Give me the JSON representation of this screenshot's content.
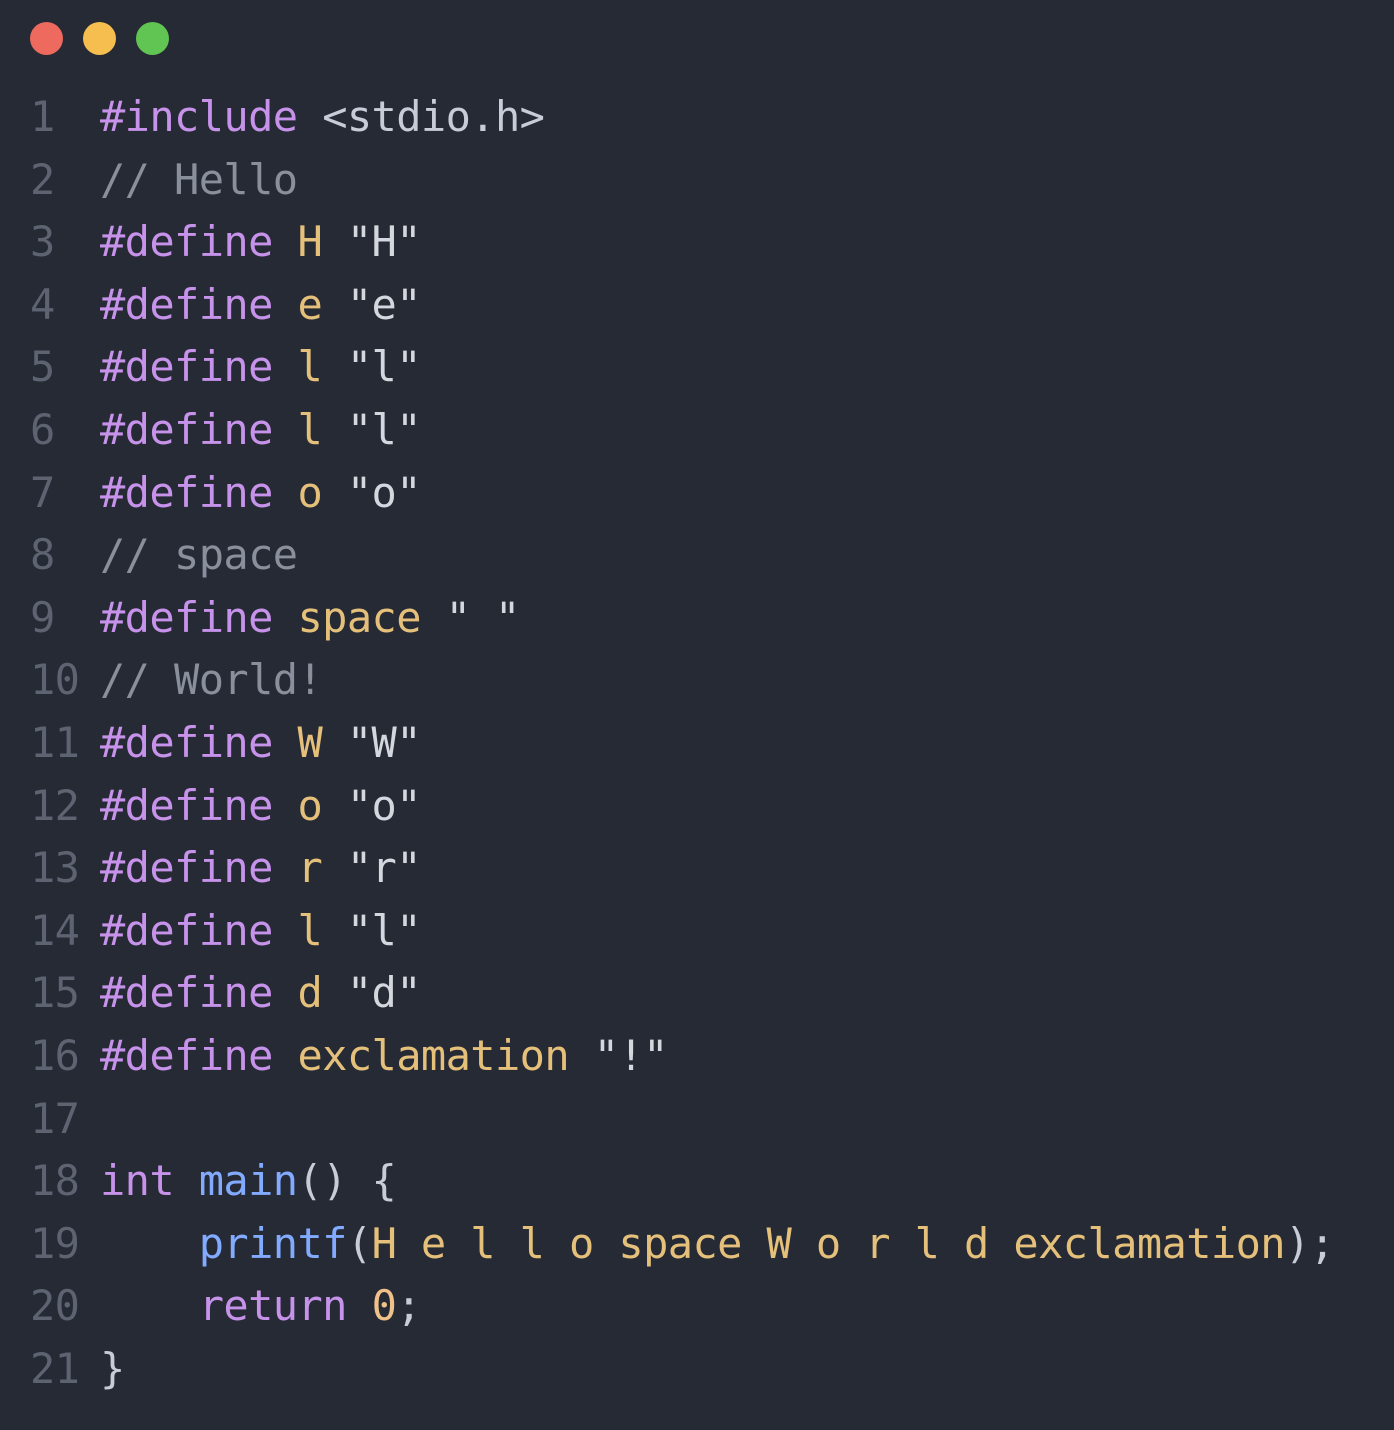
{
  "window": {
    "controls": {
      "close_color": "#ee6a5f",
      "minimize_color": "#f5be4f",
      "maximize_color": "#61c554"
    }
  },
  "editor": {
    "language": "c",
    "lines": [
      {
        "number": "1",
        "tokens": [
          {
            "t": "#include",
            "c": "directive"
          },
          {
            "t": " ",
            "c": "plain"
          },
          {
            "t": "<stdio.h>",
            "c": "header"
          }
        ]
      },
      {
        "number": "2",
        "tokens": [
          {
            "t": "// Hello",
            "c": "comment"
          }
        ]
      },
      {
        "number": "3",
        "tokens": [
          {
            "t": "#define",
            "c": "directive"
          },
          {
            "t": " ",
            "c": "plain"
          },
          {
            "t": "H",
            "c": "macro"
          },
          {
            "t": " ",
            "c": "plain"
          },
          {
            "t": "\"H\"",
            "c": "string"
          }
        ]
      },
      {
        "number": "4",
        "tokens": [
          {
            "t": "#define",
            "c": "directive"
          },
          {
            "t": " ",
            "c": "plain"
          },
          {
            "t": "e",
            "c": "macro"
          },
          {
            "t": " ",
            "c": "plain"
          },
          {
            "t": "\"e\"",
            "c": "string"
          }
        ]
      },
      {
        "number": "5",
        "tokens": [
          {
            "t": "#define",
            "c": "directive"
          },
          {
            "t": " ",
            "c": "plain"
          },
          {
            "t": "l",
            "c": "macro"
          },
          {
            "t": " ",
            "c": "plain"
          },
          {
            "t": "\"l\"",
            "c": "string"
          }
        ]
      },
      {
        "number": "6",
        "tokens": [
          {
            "t": "#define",
            "c": "directive"
          },
          {
            "t": " ",
            "c": "plain"
          },
          {
            "t": "l",
            "c": "macro"
          },
          {
            "t": " ",
            "c": "plain"
          },
          {
            "t": "\"l\"",
            "c": "string"
          }
        ]
      },
      {
        "number": "7",
        "tokens": [
          {
            "t": "#define",
            "c": "directive"
          },
          {
            "t": " ",
            "c": "plain"
          },
          {
            "t": "o",
            "c": "macro"
          },
          {
            "t": " ",
            "c": "plain"
          },
          {
            "t": "\"o\"",
            "c": "string"
          }
        ]
      },
      {
        "number": "8",
        "tokens": [
          {
            "t": "// space",
            "c": "comment"
          }
        ]
      },
      {
        "number": "9",
        "tokens": [
          {
            "t": "#define",
            "c": "directive"
          },
          {
            "t": " ",
            "c": "plain"
          },
          {
            "t": "space",
            "c": "macro"
          },
          {
            "t": " ",
            "c": "plain"
          },
          {
            "t": "\" \"",
            "c": "string"
          }
        ]
      },
      {
        "number": "10",
        "tokens": [
          {
            "t": "// World!",
            "c": "comment"
          }
        ]
      },
      {
        "number": "11",
        "tokens": [
          {
            "t": "#define",
            "c": "directive"
          },
          {
            "t": " ",
            "c": "plain"
          },
          {
            "t": "W",
            "c": "macro"
          },
          {
            "t": " ",
            "c": "plain"
          },
          {
            "t": "\"W\"",
            "c": "string"
          }
        ]
      },
      {
        "number": "12",
        "tokens": [
          {
            "t": "#define",
            "c": "directive"
          },
          {
            "t": " ",
            "c": "plain"
          },
          {
            "t": "o",
            "c": "macro"
          },
          {
            "t": " ",
            "c": "plain"
          },
          {
            "t": "\"o\"",
            "c": "string"
          }
        ]
      },
      {
        "number": "13",
        "tokens": [
          {
            "t": "#define",
            "c": "directive"
          },
          {
            "t": " ",
            "c": "plain"
          },
          {
            "t": "r",
            "c": "macro"
          },
          {
            "t": " ",
            "c": "plain"
          },
          {
            "t": "\"r\"",
            "c": "string"
          }
        ]
      },
      {
        "number": "14",
        "tokens": [
          {
            "t": "#define",
            "c": "directive"
          },
          {
            "t": " ",
            "c": "plain"
          },
          {
            "t": "l",
            "c": "macro"
          },
          {
            "t": " ",
            "c": "plain"
          },
          {
            "t": "\"l\"",
            "c": "string"
          }
        ]
      },
      {
        "number": "15",
        "tokens": [
          {
            "t": "#define",
            "c": "directive"
          },
          {
            "t": " ",
            "c": "plain"
          },
          {
            "t": "d",
            "c": "macro"
          },
          {
            "t": " ",
            "c": "plain"
          },
          {
            "t": "\"d\"",
            "c": "string"
          }
        ]
      },
      {
        "number": "16",
        "tokens": [
          {
            "t": "#define",
            "c": "directive"
          },
          {
            "t": " ",
            "c": "plain"
          },
          {
            "t": "exclamation",
            "c": "macro"
          },
          {
            "t": " ",
            "c": "plain"
          },
          {
            "t": "\"!\"",
            "c": "string"
          }
        ]
      },
      {
        "number": "17",
        "tokens": []
      },
      {
        "number": "18",
        "tokens": [
          {
            "t": "int",
            "c": "keyword"
          },
          {
            "t": " ",
            "c": "plain"
          },
          {
            "t": "main",
            "c": "function"
          },
          {
            "t": "() {",
            "c": "punct"
          }
        ]
      },
      {
        "number": "19",
        "tokens": [
          {
            "t": "    ",
            "c": "plain"
          },
          {
            "t": "printf",
            "c": "function"
          },
          {
            "t": "(",
            "c": "punct"
          },
          {
            "t": "H e l l o space W o r l d exclamation",
            "c": "macro"
          },
          {
            "t": ");",
            "c": "punct"
          }
        ]
      },
      {
        "number": "20",
        "tokens": [
          {
            "t": "    ",
            "c": "plain"
          },
          {
            "t": "return",
            "c": "keyword"
          },
          {
            "t": " ",
            "c": "plain"
          },
          {
            "t": "0",
            "c": "number"
          },
          {
            "t": ";",
            "c": "punct"
          }
        ]
      },
      {
        "number": "21",
        "tokens": [
          {
            "t": "}",
            "c": "punct"
          }
        ]
      }
    ]
  }
}
